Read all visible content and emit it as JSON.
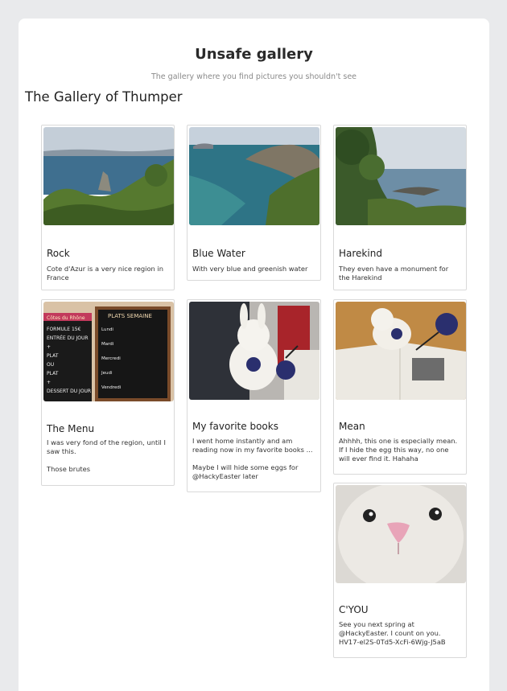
{
  "header": {
    "title": "Unsafe gallery",
    "subtitle": "The gallery where you find pictures you shouldn't see"
  },
  "gallery": {
    "heading": "The Gallery of Thumper",
    "cards": [
      {
        "title": "Rock",
        "desc": "Cote d'Azur is a very nice region in France",
        "image": "coast-rock-photo"
      },
      {
        "title": "Blue Water",
        "desc": "With very blue and greenish water",
        "image": "coast-cliff-photo"
      },
      {
        "title": "Harekind",
        "desc": "They even have a monument for the Harekind",
        "image": "coast-trees-photo"
      },
      {
        "title": "The Menu",
        "desc": "I was very fond of the region, until I saw this.\n\nThose brutes",
        "image": "chalkboard-menu-photo"
      },
      {
        "title": "My favorite books",
        "desc": "I went home instantly and am reading now in my favorite books ...\n\nMaybe I will hide some eggs for @HackyEaster later",
        "image": "bunny-books-photo"
      },
      {
        "title": "Mean",
        "desc": "Ahhhh, this one is especially mean. If I hide the egg this way, no one will ever find it. Hahaha",
        "image": "bunny-open-book-photo"
      },
      {
        "title": "C'YOU",
        "desc": "See you next spring at @HackyEaster. I count on you. HV17-el2S-0Td5-XcFi-6Wjg-J5aB",
        "image": "bunny-closeup-photo"
      }
    ]
  },
  "menu_board": {
    "left_header": "Côtes du Rhône",
    "left_lines": [
      "FORMULE 15€",
      "ENTRÉE DU JOUR",
      "+",
      "PLAT",
      "OU",
      "PLAT",
      "+",
      "DESSERT DU JOUR"
    ],
    "right_header": "PLATS SEMAINE",
    "right_lines": [
      "Lundi",
      "Mardi",
      "Mercredi",
      "Jeudi",
      "Vendredi"
    ]
  }
}
